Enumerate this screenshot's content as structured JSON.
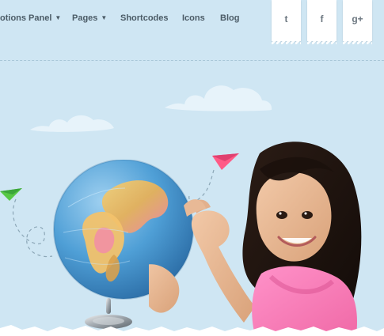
{
  "nav": {
    "items": [
      {
        "label": "otions Panel",
        "has_chevron": true
      },
      {
        "label": "Pages",
        "has_chevron": true
      },
      {
        "label": "Shortcodes",
        "has_chevron": false
      },
      {
        "label": "Icons",
        "has_chevron": false
      },
      {
        "label": "Blog",
        "has_chevron": false
      }
    ]
  },
  "social": {
    "twitter": "t",
    "facebook": "f",
    "google_plus": "g+"
  },
  "colors": {
    "background": "#cfe6f3",
    "nav_text": "#4b5b66",
    "accent_pink": "#ff5a86",
    "accent_green": "#57c845"
  },
  "icons": {
    "twitter": "twitter-icon",
    "facebook": "facebook-icon",
    "google_plus": "google-plus-icon",
    "chevron": "chevron-down-icon"
  }
}
